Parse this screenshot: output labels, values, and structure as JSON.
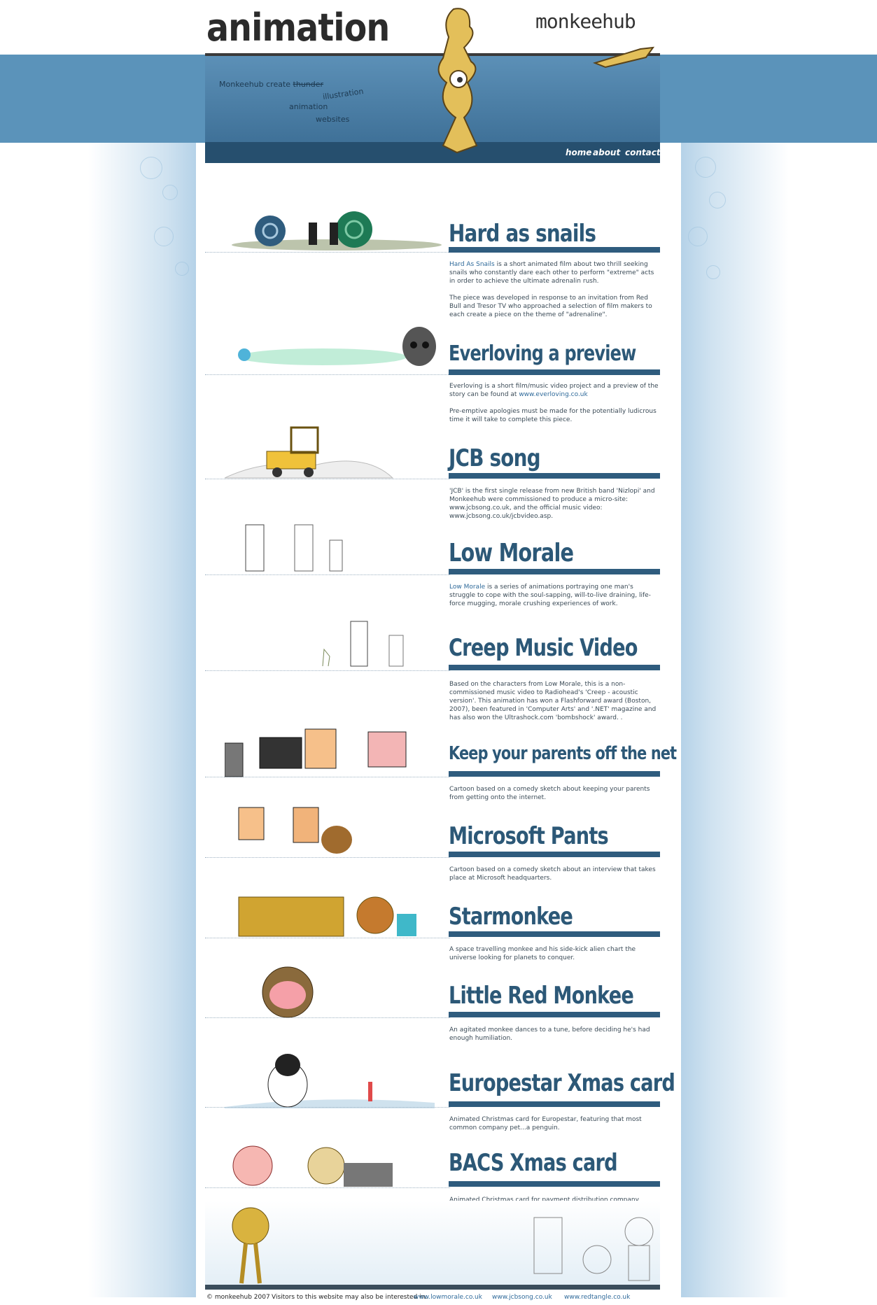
{
  "header": {
    "section_logo": "animation",
    "brand": "monkeehub",
    "tagline": {
      "lead": "Monkeehub create",
      "struck": "thunder",
      "items": [
        "illustration",
        "animation",
        "websites"
      ]
    }
  },
  "nav": {
    "items": [
      {
        "label": "home"
      },
      {
        "label": "about"
      },
      {
        "label": "contact"
      }
    ]
  },
  "sections": [
    {
      "title": "Hard as snails",
      "paragraphs": [
        {
          "link": "Hard As Snails",
          "text": " is a short animated film about two thrill seeking snails who constantly dare each other to perform \"extreme\" acts in order to achieve the ultimate adrenalin rush."
        },
        {
          "text": "The piece was developed in response to an invitation from Red Bull and Tresor TV who approached a selection of film makers to each create a piece on the theme of \"adrenaline\"."
        }
      ]
    },
    {
      "title": "Everloving a preview",
      "paragraphs": [
        {
          "text": "Everloving is a short film/music video project and a preview of the story can be found at ",
          "link": "www.everloving.co.uk"
        },
        {
          "text": "Pre-emptive apologies must be made for the potentially ludicrous time it will take to complete this piece."
        }
      ]
    },
    {
      "title": "JCB song",
      "paragraphs": [
        {
          "text": "'JCB' is the first single release from new British band 'Nizlopi' and Monkeehub were commissioned to produce a micro-site: www.jcbsong.co.uk, and the official music video: www.jcbsong.co.uk/jcbvideo.asp."
        }
      ]
    },
    {
      "title": "Low Morale",
      "paragraphs": [
        {
          "link": "Low Morale",
          "text": " is a series of animations portraying one man's struggle to cope with the soul-sapping, will-to-live draining, life-force mugging, morale crushing experiences of work."
        }
      ]
    },
    {
      "title": "Creep Music Video",
      "paragraphs": [
        {
          "text": "Based on the characters from Low Morale, this is a non-commissioned music video to Radiohead's 'Creep - acoustic version'. This animation has won a Flashforward award (Boston, 2007), been featured in 'Computer Arts' and '.NET' magazine and has also won the Ultrashock.com 'bombshock' award. ."
        }
      ]
    },
    {
      "title": "Keep your parents off the net",
      "paragraphs": [
        {
          "text": "Cartoon based on a comedy sketch about keeping your parents from getting onto the internet."
        }
      ]
    },
    {
      "title": "Microsoft Pants",
      "paragraphs": [
        {
          "text": "Cartoon based on a comedy sketch about an interview that takes place at Microsoft headquarters."
        }
      ]
    },
    {
      "title": "Starmonkee",
      "paragraphs": [
        {
          "text": "A space travelling monkee and his side-kick alien chart the universe looking for planets to conquer."
        }
      ]
    },
    {
      "title": "Little Red Monkee",
      "paragraphs": [
        {
          "text": "An agitated monkee dances to a tune, before deciding he's had enough humiliation."
        }
      ]
    },
    {
      "title": "Europestar Xmas card",
      "paragraphs": [
        {
          "text": "Animated Christmas card for Europestar, featuring that most common company pet...a penguin."
        }
      ]
    },
    {
      "title": "BACS Xmas card",
      "paragraphs": [
        {
          "text": "Animated Christmas card for payment distribution company BACS."
        }
      ]
    }
  ],
  "footer": {
    "copyright": "© monkeehub 2007",
    "interest": "Visitors to this website may also be interested in:",
    "links": [
      "www.lowmorale.co.uk",
      "www.jcbsong.co.uk",
      "www.redtangle.co.uk"
    ]
  },
  "colors": {
    "band": "#5b93ba",
    "navbar": "#264f6e",
    "section_bar": "#2f5c7e",
    "title": "#2c5877",
    "link": "#2f6a9a"
  }
}
